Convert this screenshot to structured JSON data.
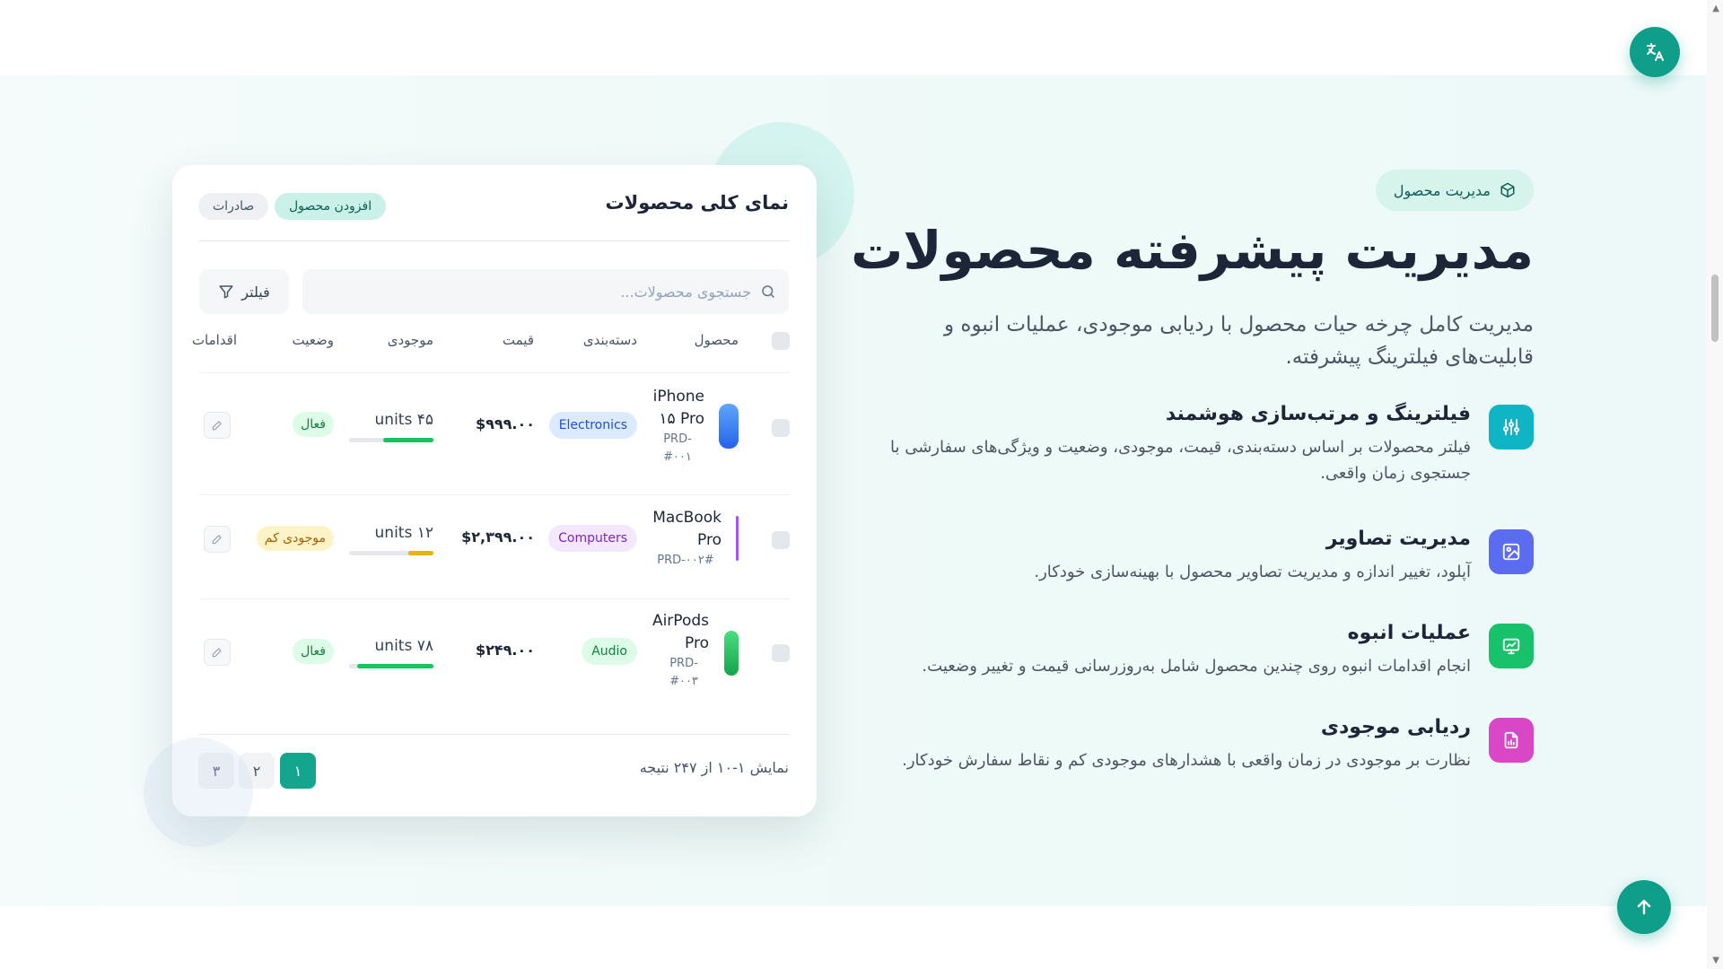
{
  "hero": {
    "badge": "مدیریت محصول",
    "title": "مدیریت پیشرفته محصولات",
    "description": "مدیریت کامل چرخه حیات محصول با ردیابی موجودی، عملیات انبوه و قابلیت‌های فیلترینگ پیشرفته."
  },
  "features": [
    {
      "title": "فیلترینگ و مرتب‌سازی هوشمند",
      "desc": "فیلتر محصولات بر اساس دسته‌بندی، قیمت، موجودی، وضعیت و ویژگی‌های سفارشی با جستجوی زمان واقعی.",
      "icon": "sliders-icon",
      "color": "#0fb5c5"
    },
    {
      "title": "مدیریت تصاویر",
      "desc": "آپلود، تغییر اندازه و مدیریت تصاویر محصول با بهینه‌سازی خودکار.",
      "icon": "image-icon",
      "color": "#5b6cf0"
    },
    {
      "title": "عملیات انبوه",
      "desc": "انجام اقدامات انبوه روی چندین محصول شامل به‌روزرسانی قیمت و تغییر وضعیت.",
      "icon": "chart-board-icon",
      "color": "#18c26a"
    },
    {
      "title": "ردیابی موجودی",
      "desc": "نظارت بر موجودی در زمان واقعی با هشدارهای موجودی کم و نقاط سفارش خودکار.",
      "icon": "report-icon",
      "color": "#d946c6"
    }
  ],
  "card": {
    "title": "نمای کلی محصولات",
    "add_label": "افزودن محصول",
    "export_label": "صادرات",
    "search_placeholder": "جستجوی محصولات...",
    "filter_label": "فیلتر",
    "columns": [
      "محصول",
      "دسته‌بندی",
      "قیمت",
      "موجودی",
      "وضعیت",
      "اقدامات"
    ],
    "rows": [
      {
        "name": "iPhone ۱۵ Pro",
        "sku": "PRD-#۰۰۱",
        "category": "Electronics",
        "price": "$۹۹۹.۰۰",
        "stock": "units ۴۵",
        "stock_level": 0.6,
        "status": "فعال",
        "thumb_color": "#3b82f6",
        "cat_bg": "#dbeafe",
        "cat_fg": "#1d4ed8",
        "status_bg": "#dcfce7",
        "status_fg": "#15803d",
        "bar_color": "#16c35c"
      },
      {
        "name": "MacBook Pro",
        "sku": "PRD-۰۰۲#",
        "category": "Computers",
        "price": "$۲,۳۹۹.۰۰",
        "stock": "units ۱۲",
        "stock_level": 0.3,
        "status": "موجودی کم",
        "thumb_color": "#a855f7",
        "cat_bg": "#f3e8ff",
        "cat_fg": "#7e22ce",
        "status_bg": "#fef3c7",
        "status_fg": "#a16207",
        "bar_color": "#eab308"
      },
      {
        "name": "AirPods Pro",
        "sku": "PRD-#۰۰۳",
        "category": "Audio",
        "price": "$۲۴۹.۰۰",
        "stock": "units ۷۸",
        "stock_level": 0.9,
        "status": "فعال",
        "thumb_color": "#22c55e",
        "cat_bg": "#dcfce7",
        "cat_fg": "#15803d",
        "status_bg": "#dcfce7",
        "status_fg": "#15803d",
        "bar_color": "#16c35c"
      }
    ],
    "results_text": "نمایش ۱-۱۰ از ۲۴۷ نتیجه",
    "pages": [
      "۱",
      "۲",
      "۳"
    ],
    "active_page": "۱"
  }
}
